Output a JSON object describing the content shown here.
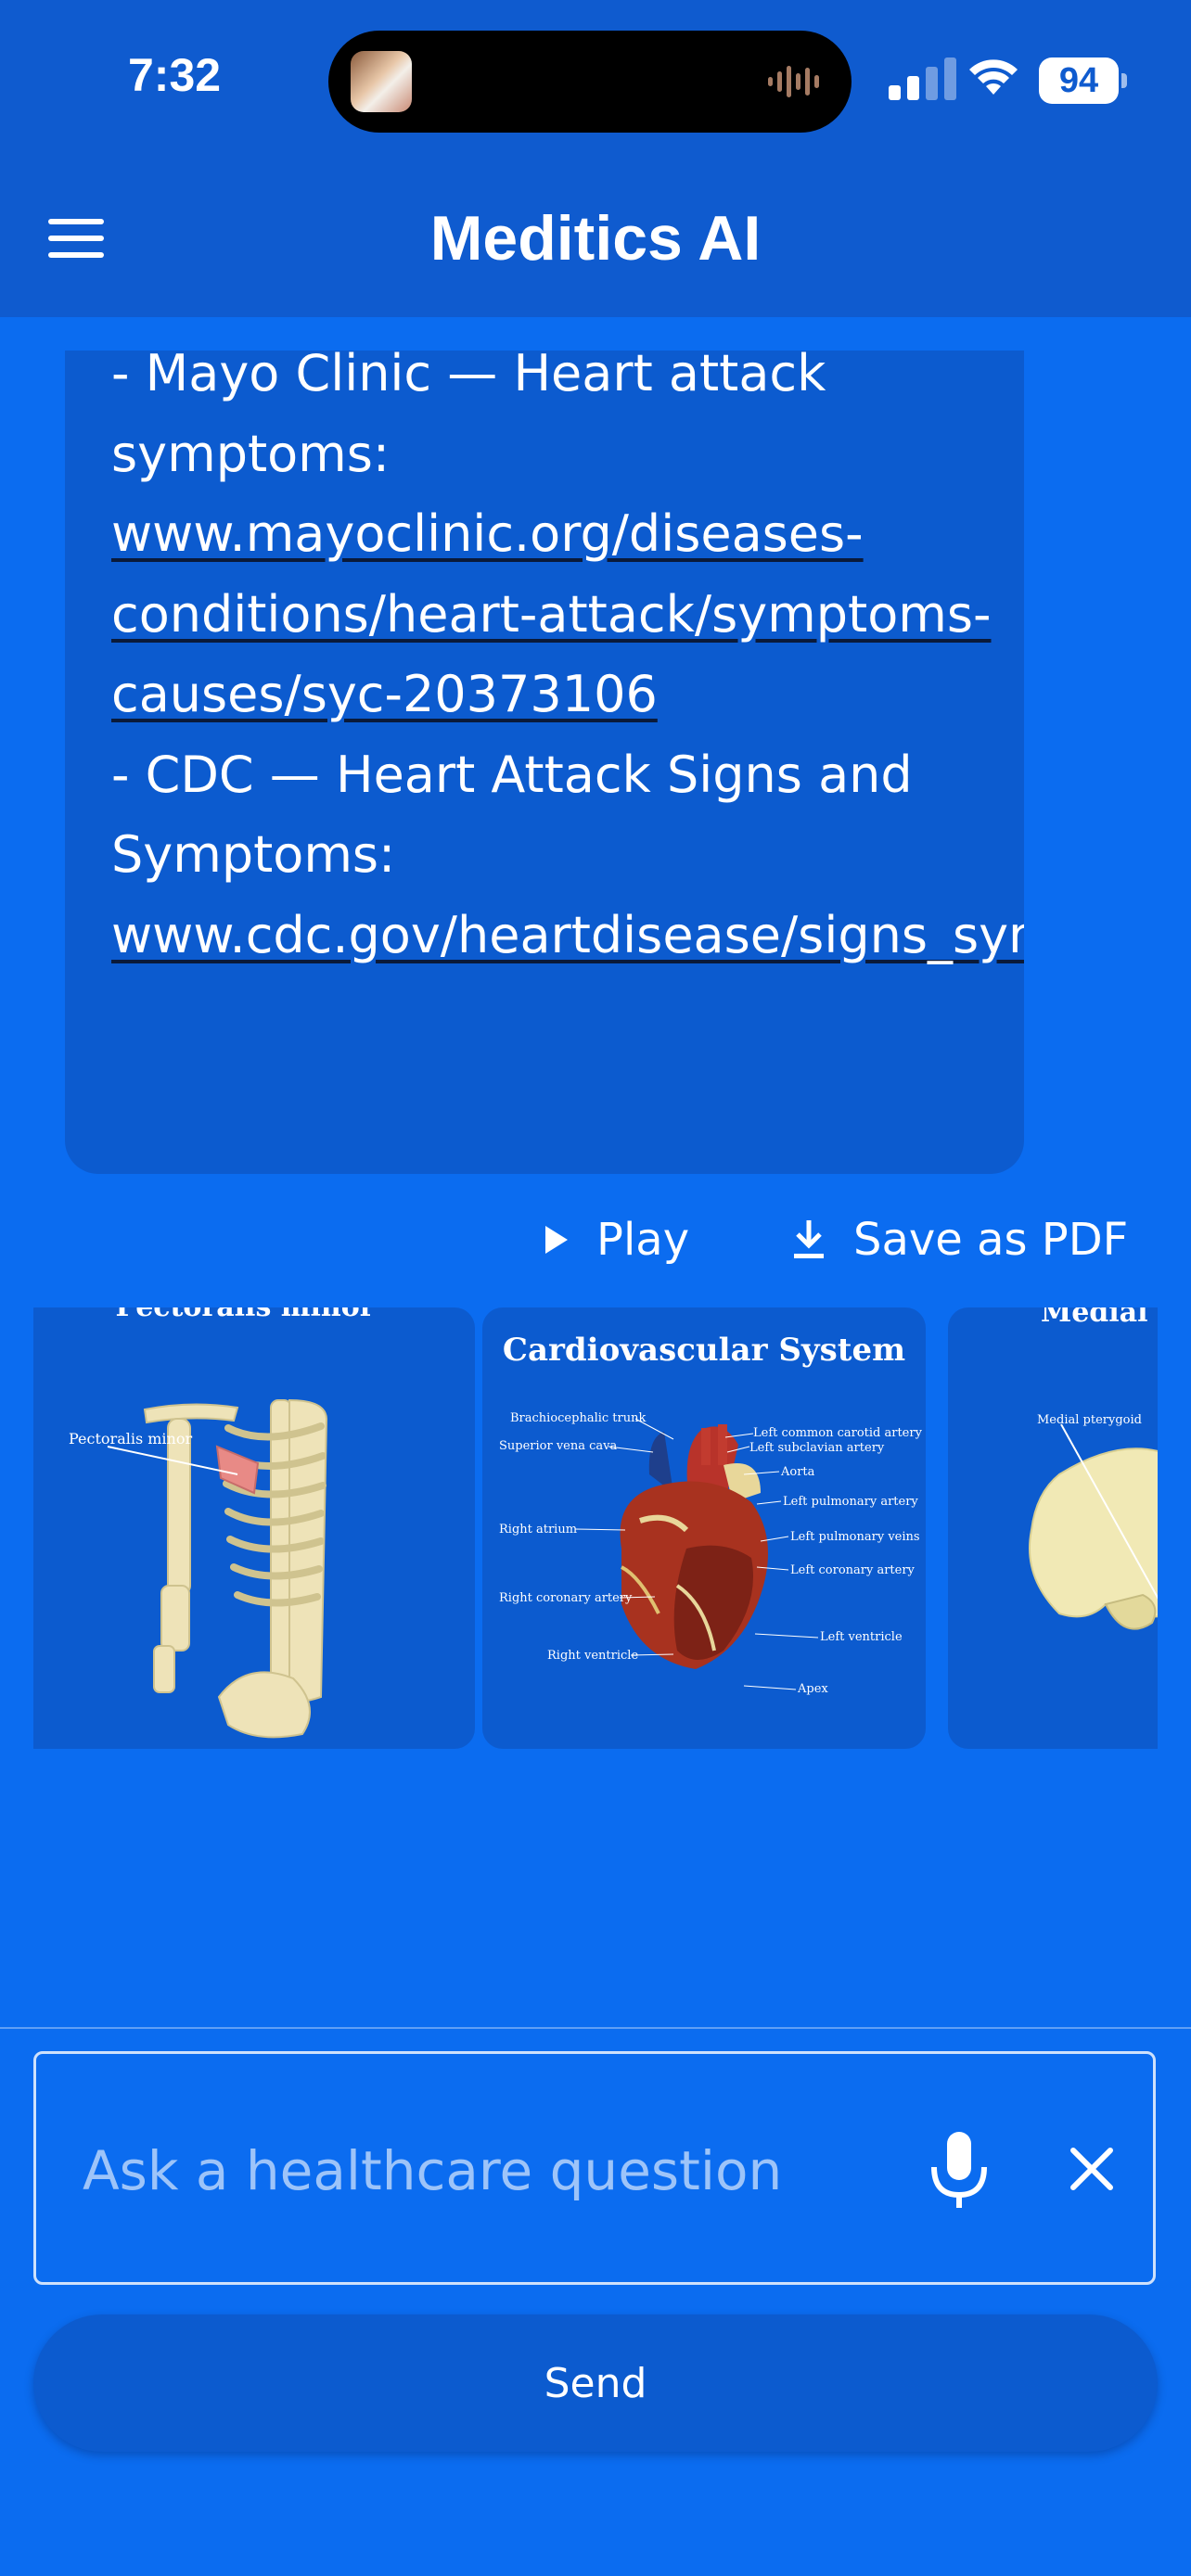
{
  "status_bar": {
    "time": "7:32",
    "battery": "94"
  },
  "header": {
    "title": "Meditics AI"
  },
  "message": {
    "source1_prefix": "- Mayo Clinic — Heart attack symptoms: ",
    "source1_link": "www.mayoclinic.org/diseases-conditions/heart-attack/symptoms-causes/syc-20373106",
    "source2_prefix": "- CDC — Heart Attack Signs and Symptoms: ",
    "source2_link": "www.cdc.gov/heartdisease/signs_symptoms.htm"
  },
  "actions": {
    "play_label": "Play",
    "save_pdf_label": "Save as PDF"
  },
  "images": [
    {
      "title": "Pectoralis minor",
      "labels": [
        "Pectoralis minor"
      ]
    },
    {
      "title": "Cardiovascular System",
      "labels": [
        "Brachiocephalic trunk",
        "Superior vena cava",
        "Right atrium",
        "Right coronary artery",
        "Right ventricle",
        "Left common carotid artery",
        "Left subclavian artery",
        "Aorta",
        "Left pulmonary artery",
        "Left pulmonary veins",
        "Left coronary artery",
        "Left ventricle",
        "Apex"
      ]
    },
    {
      "title": "Medial pterygoid",
      "labels": [
        "Medial pterygoid"
      ]
    }
  ],
  "composer": {
    "placeholder": "Ask a healthcare question",
    "send_label": "Send"
  },
  "colors": {
    "background": "#0b6cf0",
    "header": "#0f5bcf",
    "bubble": "#0c5bcf",
    "text": "#ffffff"
  }
}
